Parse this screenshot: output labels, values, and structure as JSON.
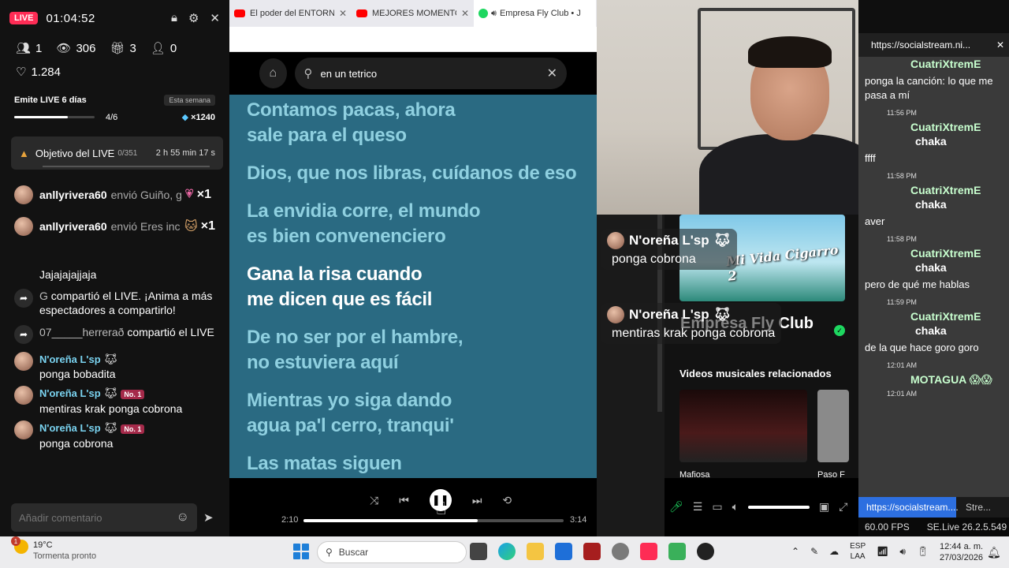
{
  "live": {
    "badge": "LIVE",
    "duration": "01:04:52",
    "stats": [
      {
        "icon": "viewers-icon",
        "value": "1"
      },
      {
        "icon": "eye-icon",
        "value": "306"
      },
      {
        "icon": "gift-icon",
        "value": "3"
      },
      {
        "icon": "user-add-icon",
        "value": "0"
      }
    ],
    "likes": "1.284",
    "streak": {
      "title": "Emite LIVE 6 días",
      "tag": "Esta semana",
      "progress": "4/6",
      "progress_fraction": 0.67,
      "gems": "×1240"
    },
    "goal": {
      "label": "Objetivo del LIVE",
      "count": "0/351",
      "time": "2 h 55 min 17 s"
    },
    "gifts": [
      {
        "user": "anllyrivera60",
        "action": "envió Guiño, g",
        "count": "×1"
      },
      {
        "user": "anllyrivera60",
        "action": "envió Eres inc",
        "count": "×1"
      }
    ],
    "chat": [
      {
        "text": "Jajajajajjaja"
      },
      {
        "share": true,
        "user": "G",
        "text": "compartió el LIVE. ¡Anima a más espectadores a compartirlo!"
      },
      {
        "share": true,
        "user": "07_____herrerað",
        "text": "compartió el LIVE"
      },
      {
        "user": "N'oreña L'sp",
        "text": "ponga bobadita"
      },
      {
        "user": "N'oreña L'sp",
        "badge": "No. 1",
        "text": "mentiras krak ponga cobrona"
      },
      {
        "user": "N'oreña L'sp",
        "badge": "No. 1",
        "text": "ponga cobrona"
      }
    ],
    "comment_placeholder": "Añadir comentario"
  },
  "browser": {
    "tabs": [
      {
        "title": "El poder del ENTORNO o",
        "kind": "youtube"
      },
      {
        "title": "MEJORES MOMENTOS o",
        "kind": "youtube"
      },
      {
        "title": "Empresa Fly Club • J",
        "kind": "spotify"
      }
    ],
    "search_query": "en un tetrico",
    "lyrics": [
      {
        "text": "Contamos pacas, ahora sale para el queso",
        "current": false
      },
      {
        "text": "Dios, que nos libras, cuídanos de eso",
        "current": false
      },
      {
        "text": "La envidia corre, el mundo es bien convenenciero",
        "current": false
      },
      {
        "text": "Gana la risa cuando me dicen que es fácil",
        "current": true
      },
      {
        "text": "De no ser por el hambre, no estuviera aquí",
        "current": false
      },
      {
        "text": "Mientras yo siga dando agua pa'l cerro, tranqui'",
        "current": false
      },
      {
        "text": "Las matas siguen",
        "current": false
      }
    ],
    "time_current": "2:10",
    "time_total": "3:14",
    "progress_fraction": 0.67
  },
  "spotify_right": {
    "album_title": "Mi Vida Cigarro 2",
    "artist": "Empresa Fly Club",
    "related_heading": "Videos musicales relacionados",
    "videos": [
      "Mafiosa",
      "Paso F"
    ]
  },
  "overlay": [
    {
      "user": "N'oreña L'sp",
      "text": "ponga cobrona"
    },
    {
      "user": "N'oreña L'sp",
      "text": "mentiras krak ponga cobrona"
    }
  ],
  "socialstream": {
    "url": "https://socialstream.ni...",
    "lines": [
      {
        "type": "green",
        "text": "CuatriXtremE"
      },
      {
        "type": "text",
        "text": "ponga la canción: lo que me pasa a mí"
      },
      {
        "type": "time",
        "text": "11:56 PM"
      },
      {
        "type": "green",
        "text": "CuatriXtremE"
      },
      {
        "type": "chaka",
        "text": "chaka"
      },
      {
        "type": "text",
        "text": "ffff"
      },
      {
        "type": "time",
        "text": "11:58 PM"
      },
      {
        "type": "green",
        "text": "CuatriXtremE"
      },
      {
        "type": "chaka",
        "text": "chaka"
      },
      {
        "type": "text",
        "text": "aver"
      },
      {
        "type": "time",
        "text": "11:58 PM"
      },
      {
        "type": "green",
        "text": "CuatriXtremE"
      },
      {
        "type": "chaka",
        "text": "chaka"
      },
      {
        "type": "text",
        "text": "pero de qué me hablas"
      },
      {
        "type": "time",
        "text": "11:59 PM"
      },
      {
        "type": "green",
        "text": "CuatriXtremE"
      },
      {
        "type": "chaka",
        "text": "chaka"
      },
      {
        "type": "text",
        "text": "de la que hace goro goro"
      },
      {
        "type": "time",
        "text": "12:01 AM"
      },
      {
        "type": "green",
        "text": "MOTAGUA 😱😱"
      },
      {
        "type": "time",
        "text": "12:01 AM"
      }
    ],
    "tab_url": "https://socialstream....",
    "tab2": "Stre...",
    "fps": "60.00 FPS",
    "version": "SE.Live 26.2.5.549"
  },
  "taskbar": {
    "weather_badge": "1",
    "temp": "19°C",
    "weather_text": "Tormenta pronto",
    "search": "Buscar",
    "lang1": "ESP",
    "lang2": "LAA",
    "time": "12:44 a. m.",
    "date": "27/03/2026"
  }
}
